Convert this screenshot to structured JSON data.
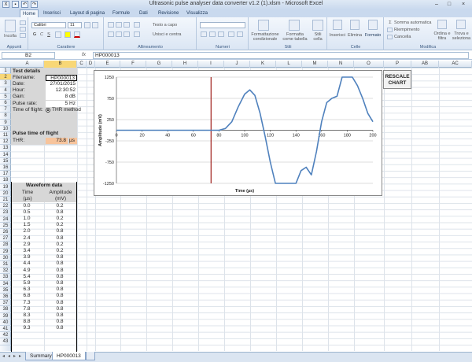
{
  "window": {
    "title": "Ultrasonic pulse analyser data converter v1.2 (1).xlsm - Microsoft Excel",
    "minimize": "–",
    "maximize": "□",
    "close": "×"
  },
  "ribbon_tabs": [
    "Home",
    "Inserisci",
    "Layout di pagina",
    "Formule",
    "Dati",
    "Revisione",
    "Visualizza"
  ],
  "ribbon": {
    "paste": "Incolla",
    "font_name": "Calibri",
    "font_size": "11",
    "wrap_text": "Testo a capo",
    "merge": "Unisci e centra",
    "cond_format": "Formattazione condizionale",
    "format_table": "Formatta come tabella",
    "cell_styles": "Stili cella",
    "insert": "Inserisci",
    "delete": "Elimina",
    "format": "Formato",
    "autosum": "Somma automatica",
    "fill": "Riempimento",
    "clear": "Cancella",
    "sort": "Ordina e filtra",
    "find": "Trova e seleziona",
    "groups": [
      "Appunti",
      "Carattere",
      "Allineamento",
      "Numeri",
      "Stili",
      "Celle",
      "Modifica"
    ]
  },
  "formula_bar": {
    "name_box": "B2",
    "fx": "fx",
    "formula": "HP000013"
  },
  "columns": [
    "A",
    "B",
    "C",
    "D",
    "E",
    "F",
    "G",
    "H",
    "I",
    "J",
    "K",
    "L",
    "M",
    "N",
    "O",
    "P",
    "AB",
    "AC"
  ],
  "rows": [
    "1",
    "2",
    "3",
    "4",
    "5",
    "6",
    "7",
    "8",
    "9",
    "10",
    "11",
    "12",
    "13",
    "14",
    "15",
    "16",
    "17",
    "18",
    "19",
    "20",
    "21",
    "22",
    "23",
    "24",
    "25",
    "26",
    "27",
    "28",
    "29",
    "30",
    "31",
    "32",
    "33",
    "34",
    "35",
    "36",
    "37",
    "38",
    "39",
    "40",
    "41",
    "42",
    "43"
  ],
  "test_details": {
    "header": "Test details",
    "filename_label": "Filename:",
    "filename": "HP000013",
    "date_label": "Date:",
    "date": "27/01/2015",
    "hour_label": "Hour:",
    "hour": "12:30:52",
    "gain_label": "Gain:",
    "gain": "8 dB",
    "pulse_rate_label": "Pulse rate:",
    "pulse_rate": "5 Hz",
    "tof_label": "Time of flight:",
    "tof_method": "THR method"
  },
  "pulse_tof": {
    "header": "Pulse time of flight",
    "thr_label": "THR:",
    "thr_value": "73.8",
    "thr_unit": "µs"
  },
  "waveform": {
    "header": "Waveform data",
    "col_time": "Time",
    "col_amp": "Amplitude",
    "unit_time": "(µs)",
    "unit_amp": "(mV)",
    "rows": [
      [
        "0.0",
        "0.2"
      ],
      [
        "0.5",
        "0.8"
      ],
      [
        "1.0",
        "0.2"
      ],
      [
        "1.5",
        "0.2"
      ],
      [
        "2.0",
        "0.8"
      ],
      [
        "2.4",
        "0.8"
      ],
      [
        "2.9",
        "0.2"
      ],
      [
        "3.4",
        "0.2"
      ],
      [
        "3.9",
        "0.8"
      ],
      [
        "4.4",
        "0.8"
      ],
      [
        "4.9",
        "0.8"
      ],
      [
        "5.4",
        "0.8"
      ],
      [
        "5.9",
        "0.8"
      ],
      [
        "6.3",
        "0.8"
      ],
      [
        "6.8",
        "0.8"
      ],
      [
        "7.3",
        "0.8"
      ],
      [
        "7.8",
        "0.8"
      ],
      [
        "8.3",
        "0.8"
      ],
      [
        "8.8",
        "0.8"
      ],
      [
        "9.3",
        "0.8"
      ]
    ]
  },
  "button": {
    "rescale": "RESCALE CHART"
  },
  "sheets": [
    "Summary",
    "HP000013"
  ],
  "chart_data": {
    "type": "line",
    "xlabel": "Time (µs)",
    "ylabel": "Amplitude (mV)",
    "xlim": [
      0,
      200
    ],
    "ylim": [
      -1250,
      1250
    ],
    "xticks": [
      "0",
      "20",
      "40",
      "60",
      "80",
      "100",
      "120",
      "140",
      "160",
      "180",
      "200"
    ],
    "yticks": [
      "1250",
      "750",
      "250",
      "-250",
      "-750",
      "-1250"
    ],
    "thr_line_x": 73.8,
    "series": [
      {
        "color": "#4f81bd",
        "x": [
          0,
          20,
          40,
          60,
          80,
          85,
          90,
          95,
          100,
          104,
          108,
          112,
          116,
          120,
          124,
          128,
          132,
          136,
          140,
          144,
          148,
          152,
          156,
          160,
          164,
          168,
          172,
          176,
          180,
          184,
          188,
          192,
          196,
          200
        ],
        "y": [
          0,
          0,
          0,
          0,
          0,
          40,
          200,
          550,
          850,
          950,
          820,
          400,
          -150,
          -750,
          -1250,
          -1250,
          -1250,
          -1250,
          -1250,
          -950,
          -870,
          -1050,
          -500,
          200,
          650,
          750,
          800,
          1250,
          1250,
          1250,
          1050,
          750,
          400,
          200
        ]
      }
    ]
  }
}
